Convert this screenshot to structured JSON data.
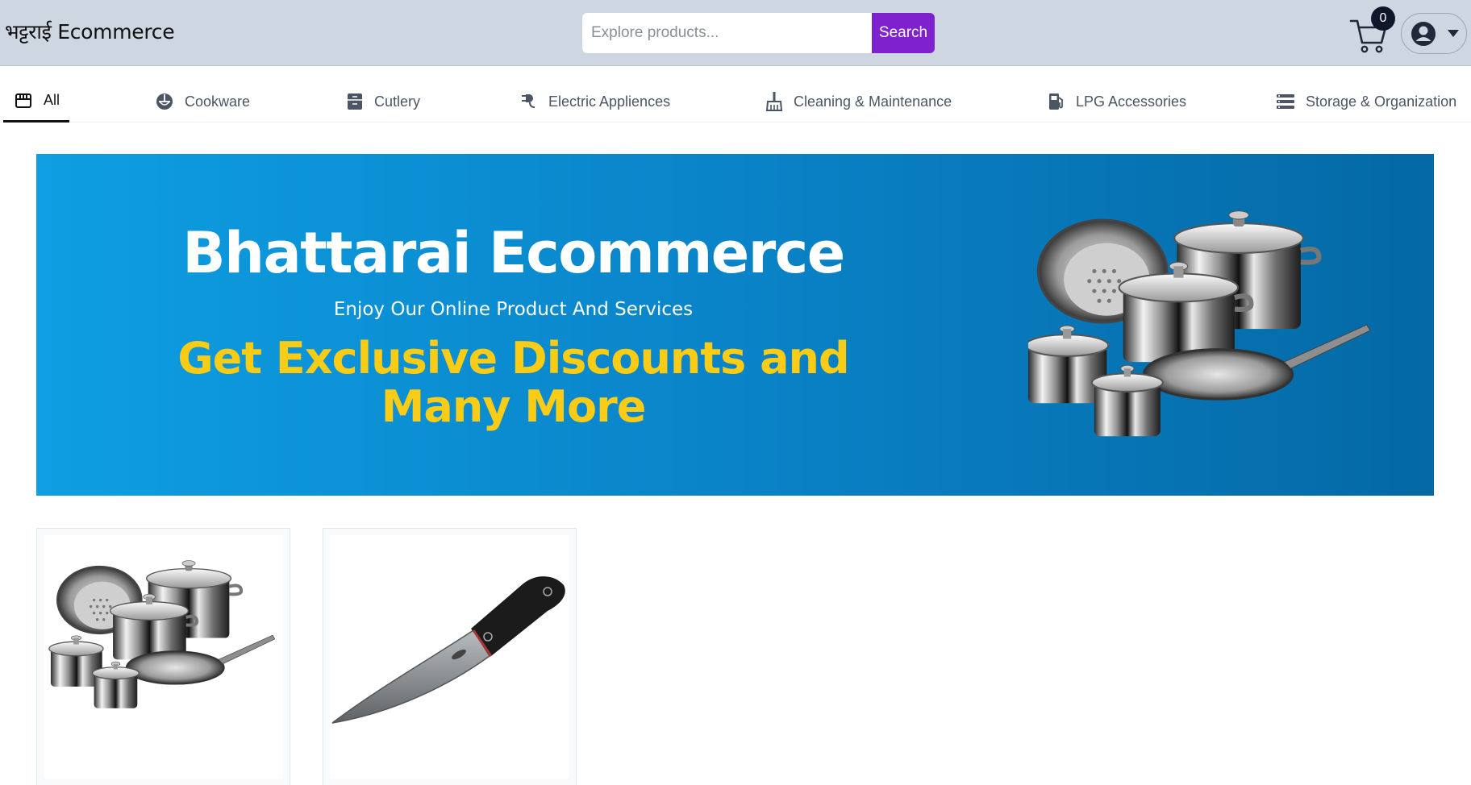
{
  "header": {
    "brand": "भट्टराई Ecommerce",
    "search": {
      "placeholder": "Explore products...",
      "value": "",
      "button_label": "Search"
    },
    "cart": {
      "count": "0",
      "icon": "cart-icon"
    },
    "user_menu": {
      "icon": "user-circle-icon",
      "caret": "caret-down-icon"
    }
  },
  "categories": [
    {
      "label": "All",
      "icon": "store-icon",
      "active": true
    },
    {
      "label": "Cookware",
      "icon": "bowl-icon",
      "active": false
    },
    {
      "label": "Cutlery",
      "icon": "cabinet-icon",
      "active": false
    },
    {
      "label": "Electric Appliences",
      "icon": "plug-icon",
      "active": false
    },
    {
      "label": "Cleaning & Maintenance",
      "icon": "broom-icon",
      "active": false
    },
    {
      "label": "LPG Accessories",
      "icon": "gas-pump-icon",
      "active": false
    },
    {
      "label": "Storage & Organization",
      "icon": "storage-list-icon",
      "active": false
    }
  ],
  "hero": {
    "title": "Bhattarai Ecommerce",
    "subtitle": "Enjoy Our Online Product And Services",
    "promo": "Get Exclusive Discounts and Many More",
    "image": "cookware-set-image"
  },
  "products": [
    {
      "image": "cookware-set-image"
    },
    {
      "image": "chef-knife-image"
    }
  ],
  "colors": {
    "header_bg": "#cdd6e1",
    "search_button": "#7e22ce",
    "hero_gradient_start": "#0e9ee2",
    "hero_gradient_end": "#0469a5",
    "promo_text": "#facc15",
    "badge_bg": "#0f172a"
  }
}
